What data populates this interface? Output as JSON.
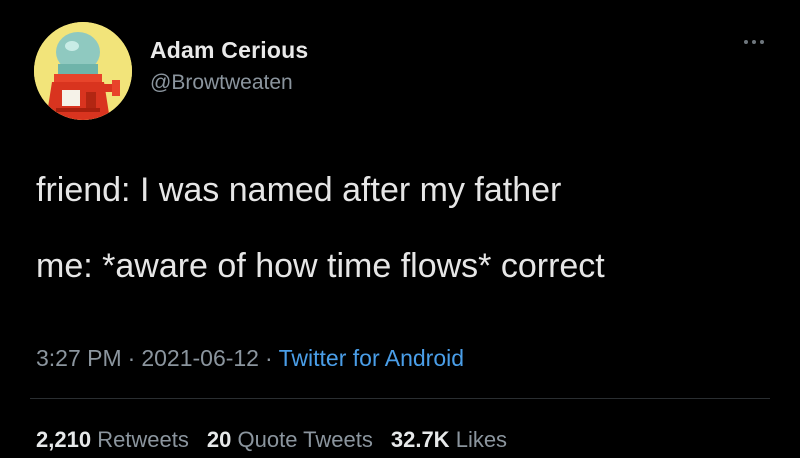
{
  "user": {
    "display_name": "Adam Cerious",
    "handle": "@Browtweaten",
    "avatar_icon": "robot-avatar-icon"
  },
  "more_icon": "more-dots-icon",
  "tweet": {
    "line1": "friend: I was named after my father",
    "line2": "me: *aware of how time flows* correct"
  },
  "meta": {
    "time": "3:27 PM",
    "separator": "·",
    "date": "2021-06-12",
    "source": "Twitter for Android"
  },
  "stats": {
    "retweets_count": "2,210",
    "retweets_label": "Retweets",
    "quotes_count": "20",
    "quotes_label": "Quote Tweets",
    "likes_count": "32.7K",
    "likes_label": "Likes"
  },
  "colors": {
    "background": "#000000",
    "text": "#e7e9ea",
    "secondary": "#8b959e",
    "link": "#4a9ee8",
    "avatar_bg": "#f2e47a"
  }
}
